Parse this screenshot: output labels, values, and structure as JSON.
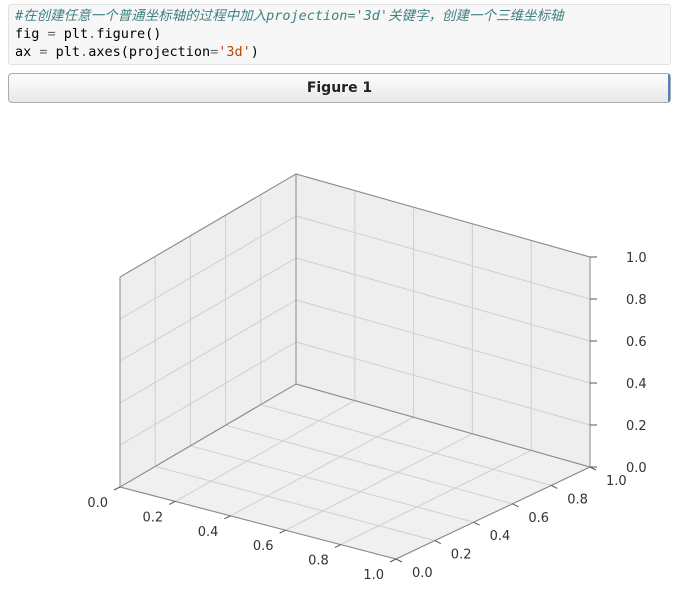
{
  "code": {
    "comment": "#在创建任意一个普通坐标轴的过程中加入projection='3d'关键字，创建一个三维坐标轴",
    "line2_a": "fig ",
    "line2_op": "=",
    "line2_b": " plt",
    "line2_dot": ".",
    "line2_c": "figure()",
    "line3_a": "ax ",
    "line3_op": "=",
    "line3_b": " plt",
    "line3_dot": ".",
    "line3_c": "axes(projection",
    "line3_eq": "=",
    "line3_str": "'3d'",
    "line3_close": ")"
  },
  "figure": {
    "title": "Figure 1"
  },
  "chart_data": {
    "type": "scatter",
    "series": [],
    "xlabel": "",
    "ylabel": "",
    "zlabel": "",
    "xlim": [
      0.0,
      1.0
    ],
    "ylim": [
      0.0,
      1.0
    ],
    "zlim": [
      0.0,
      1.0
    ],
    "x_ticks": [
      "0.0",
      "0.2",
      "0.4",
      "0.6",
      "0.8",
      "1.0"
    ],
    "y_ticks": [
      "0.0",
      "0.2",
      "0.4",
      "0.6",
      "0.8",
      "1.0"
    ],
    "z_ticks": [
      "0.0",
      "0.2",
      "0.4",
      "0.6",
      "0.8",
      "1.0"
    ],
    "grid": true,
    "projection": "3d"
  }
}
